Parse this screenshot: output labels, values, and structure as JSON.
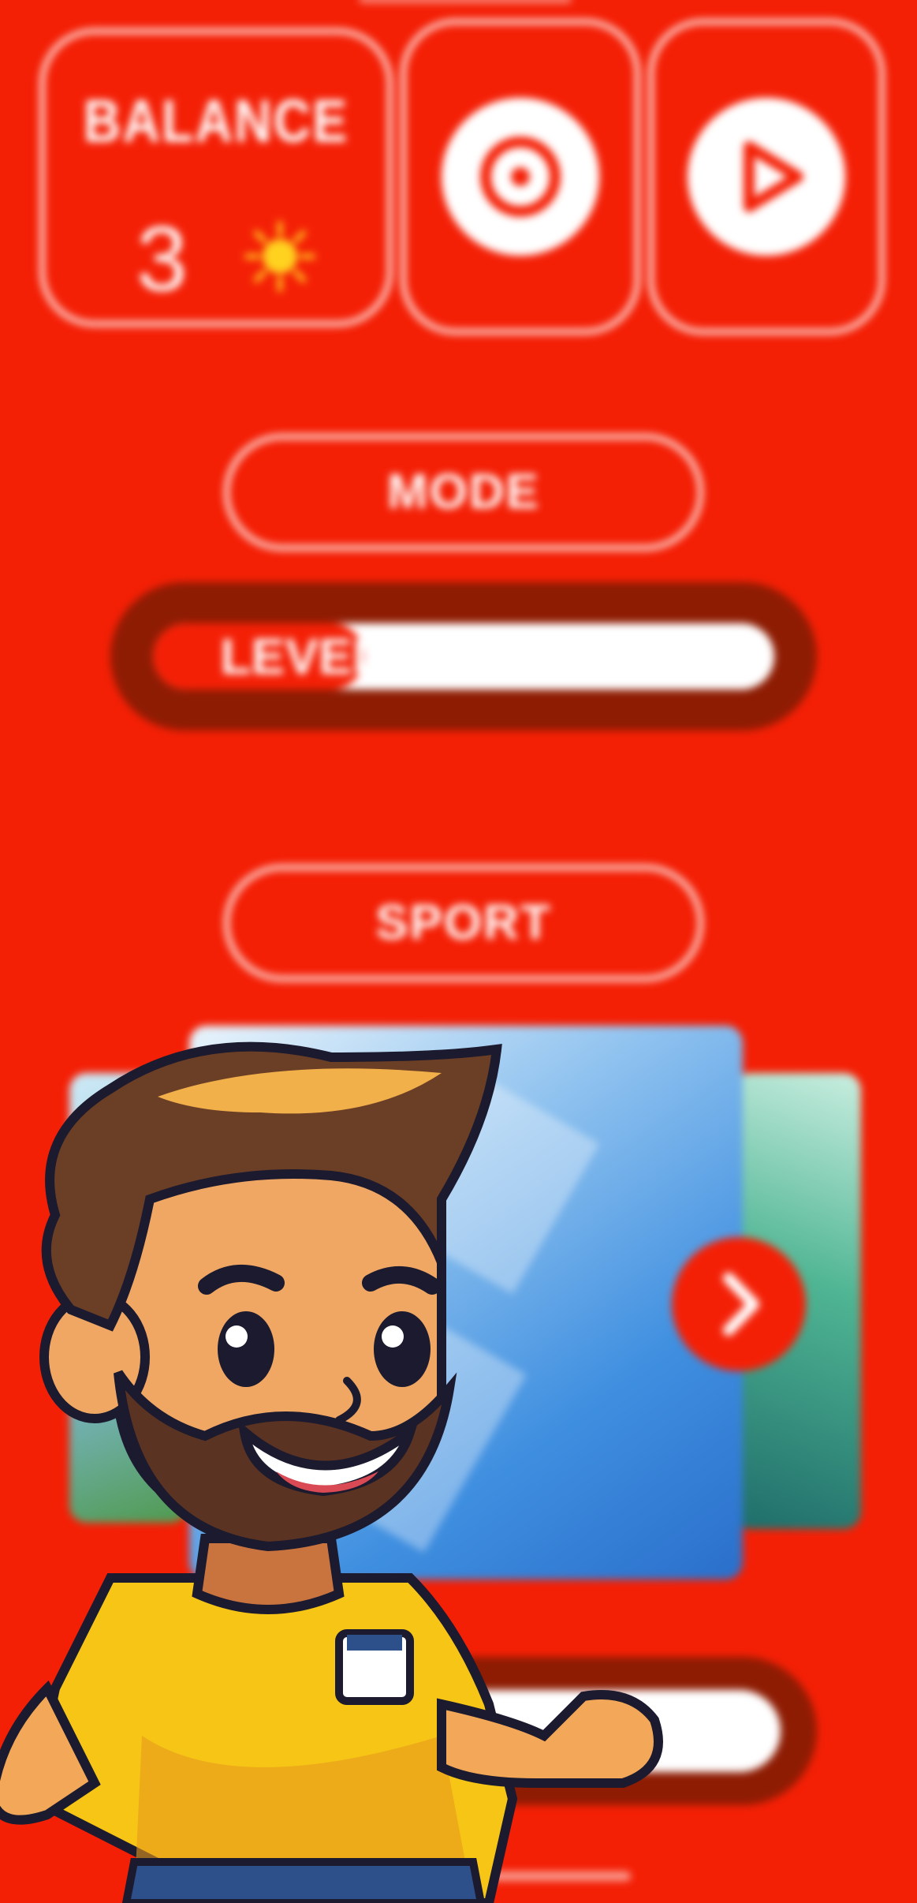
{
  "balance": {
    "title": "BALANCE",
    "value": "3",
    "icon": "sun-icon"
  },
  "buttons": {
    "settings_icon": "settings-icon",
    "play_icon": "play-icon",
    "next_icon": "chevron-right-icon"
  },
  "mode": {
    "label": "MODE"
  },
  "levels": {
    "label": "LEVELS",
    "progress": 0.34
  },
  "sport": {
    "label": "SPORT"
  },
  "colors": {
    "background": "#f42006",
    "track": "#8e1c03",
    "white": "#ffffff",
    "sun": "#ffd21f"
  }
}
